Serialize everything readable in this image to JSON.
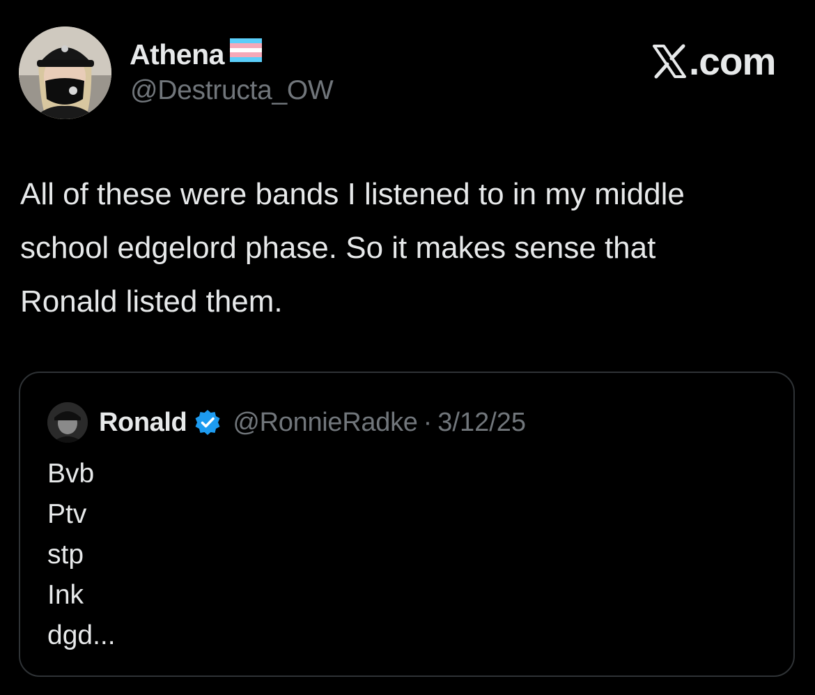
{
  "author": {
    "display_name": "Athena",
    "handle": "@Destructa_OW",
    "flag_icon": "transgender-flag-icon"
  },
  "brand": {
    "label": ".com",
    "logo_icon": "x-logo-icon"
  },
  "tweet": {
    "lines": [
      "All of these were bands I listened to in my middle",
      "school edgelord phase. So it makes sense that",
      "Ronald listed them."
    ]
  },
  "quote": {
    "display_name": "Ronald",
    "verified_icon": "verified-badge-icon",
    "handle": "@RonnieRadke",
    "separator": "·",
    "date": "3/12/25",
    "lines": [
      "Bvb",
      "Ptv",
      "stp",
      "Ink",
      "dgd..."
    ]
  },
  "colors": {
    "background": "#000000",
    "primary_text": "#e7e9ea",
    "secondary_text": "#71767b",
    "border": "#2f3336",
    "verified_blue": "#1d9bf0",
    "flag_blue": "#5bcefa",
    "flag_pink": "#f5a9b8",
    "flag_white": "#ffffff"
  }
}
